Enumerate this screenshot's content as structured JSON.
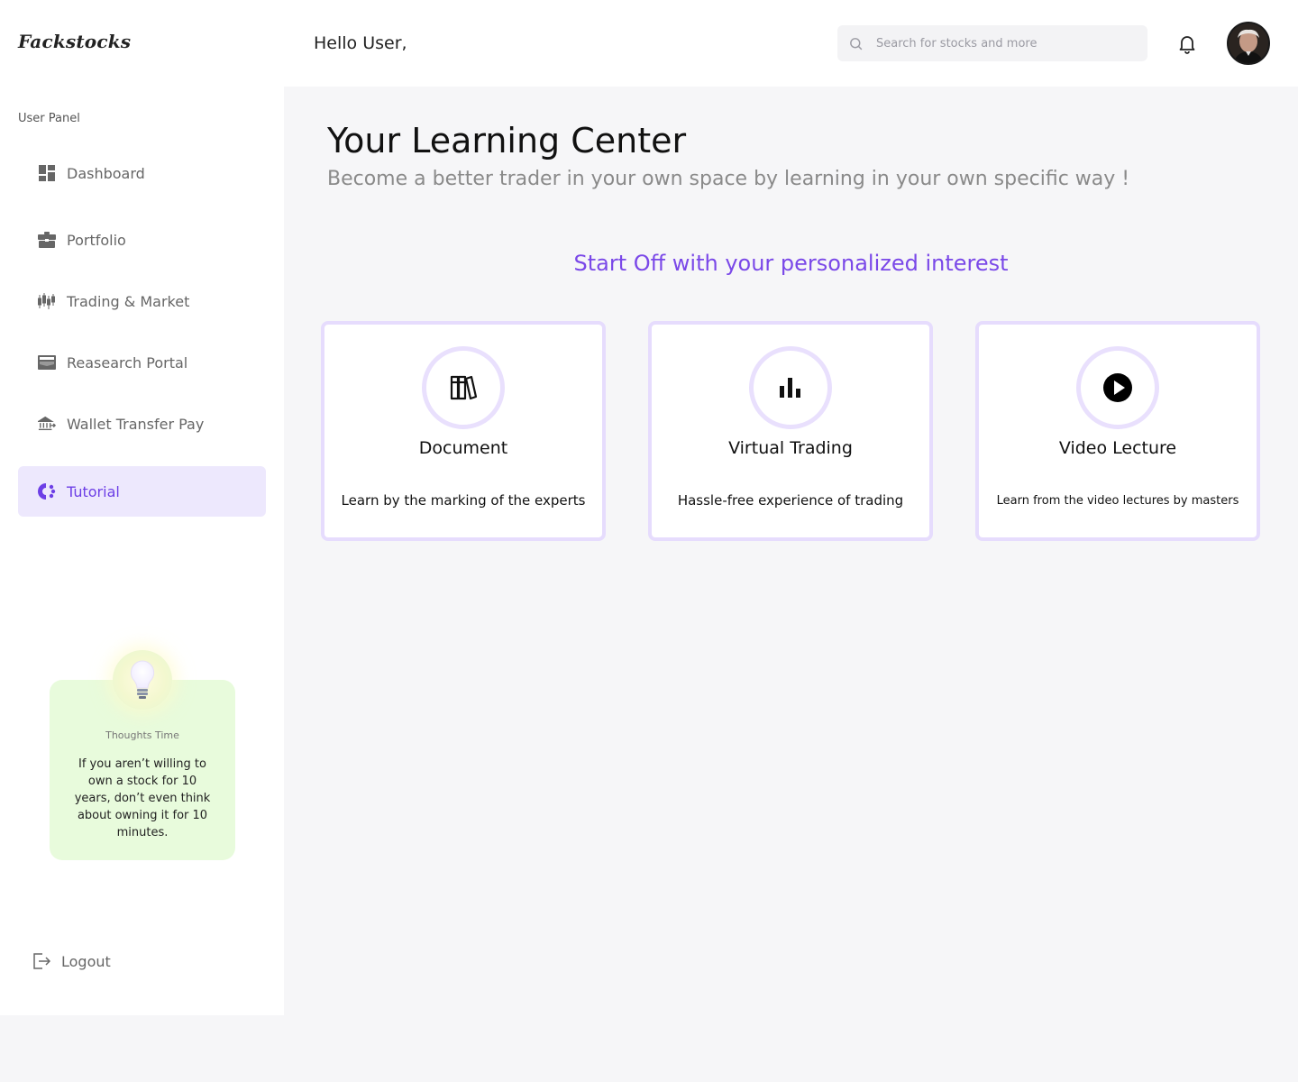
{
  "app": {
    "logo": "Fackstocks"
  },
  "header": {
    "greeting": "Hello User,",
    "search_placeholder": "Search for stocks and more"
  },
  "sidebar": {
    "panel_label": "User Panel",
    "items": [
      {
        "label": "Dashboard",
        "icon": "dashboard-icon"
      },
      {
        "label": "Portfolio",
        "icon": "briefcase-icon"
      },
      {
        "label": "Trading & Market",
        "icon": "candlestick-icon"
      },
      {
        "label": "Reasearch Portal",
        "icon": "research-icon"
      },
      {
        "label": "Wallet Transfer Pay",
        "icon": "bank-transfer-icon"
      },
      {
        "label": "Tutorial",
        "icon": "tutorial-icon",
        "active": true
      }
    ],
    "thought": {
      "title": "Thoughts Time",
      "text": "If you aren’t willing to own a stock for 10 years, don’t even think about owning it for 10 minutes."
    },
    "logout_label": "Logout"
  },
  "main": {
    "title": "Your Learning Center",
    "subtitle": "Become a better trader in your own space by learning in your own specific way !",
    "section_title": "Start Off with your personalized interest",
    "cards": [
      {
        "title": "Document",
        "description": "Learn by the marking of the experts",
        "icon": "books-icon"
      },
      {
        "title": "Virtual Trading",
        "description": "Hassle-free experience of trading",
        "icon": "bar-chart-icon"
      },
      {
        "title": "Video Lecture",
        "description": "Learn from the video lectures by masters",
        "icon": "play-icon"
      }
    ]
  },
  "colors": {
    "accent": "#7a48e8",
    "active_bg": "#ede8fd",
    "card_border": "#e6dcfd",
    "thought_bg": "#e8fbdc"
  }
}
